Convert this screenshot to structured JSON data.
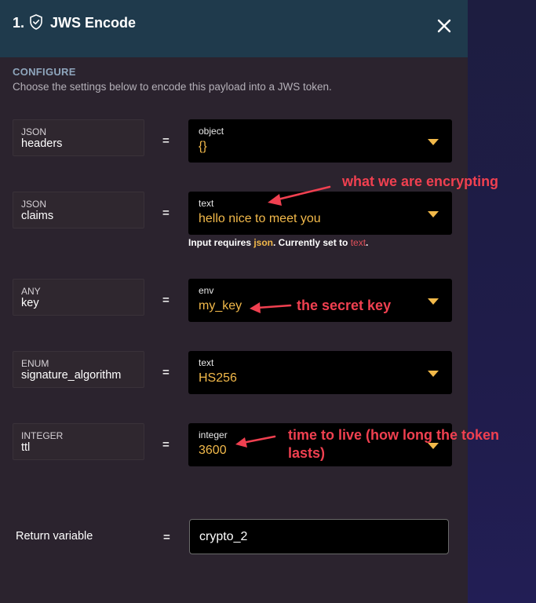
{
  "header": {
    "step": "1.",
    "icon": "shield-check-icon",
    "title": "JWS Encode",
    "close_icon": "close-icon"
  },
  "configure": {
    "title": "CONFIGURE",
    "description": "Choose the settings below to encode this payload into a JWS token."
  },
  "params": [
    {
      "type": "JSON",
      "name": "headers",
      "equals": "=",
      "value_type": "object",
      "value": "{}"
    },
    {
      "type": "JSON",
      "name": "claims",
      "equals": "=",
      "value_type": "text",
      "value": "hello nice to meet you"
    },
    {
      "type": "ANY",
      "name": "key",
      "equals": "=",
      "value_type": "env",
      "value": "my_key"
    },
    {
      "type": "ENUM",
      "name": "signature_algorithm",
      "equals": "=",
      "value_type": "text",
      "value": "HS256"
    },
    {
      "type": "INTEGER",
      "name": "ttl",
      "equals": "=",
      "value_type": "integer",
      "value": "3600"
    }
  ],
  "claims_hint": {
    "prefix": "Input requires ",
    "required": "json",
    "middle": ". Currently set to ",
    "current": "text",
    "suffix": "."
  },
  "annotations": {
    "encrypting": "what we are encrypting",
    "secret_key": "the secret key",
    "ttl_line1": "time to live (how long the token",
    "ttl_line2": "lasts)"
  },
  "return": {
    "label": "Return variable",
    "equals": "=",
    "value": "crypto_2"
  },
  "colors": {
    "header_bg": "#1f3a4c",
    "panel_bg": "#2b232e",
    "value_text": "#f2b94a",
    "annotation": "#f04050"
  }
}
